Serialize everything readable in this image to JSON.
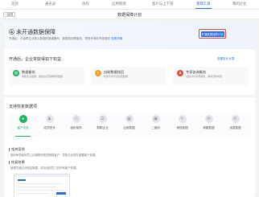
{
  "topnav": {
    "items": [
      "首页",
      "通讯录",
      "协作",
      "应用管理",
      "客户与上下游",
      "管理工具",
      "我的企业"
    ],
    "active_index": 5
  },
  "subbar": {
    "back_label": "返回",
    "title": "数据保障计划"
  },
  "hero": {
    "title": "未开通数据保障",
    "desc": "开通后，可保障企业核心数据的数据备份、数据找回等服务，享受专享的专家服务",
    "desc_link": "查看详情",
    "open_button": "开通数据保障计划"
  },
  "benefits": {
    "title": "开通后，企业将获得如下权益",
    "link": "查看定价计算",
    "items": [
      {
        "title": "数据备份",
        "desc": "保障企业数据，备份后可查看所有数据",
        "color": "#1fb35e",
        "icon": "archive-icon"
      },
      {
        "title": "自助数据找回",
        "desc": "支持不同方式找回数据",
        "color": "#f59a23",
        "icon": "refresh-icon"
      },
      {
        "title": "专家咨询服务",
        "desc": "包括1对1专家服务，需求及时响应",
        "color": "#e24a3b",
        "icon": "expert-icon"
      }
    ]
  },
  "types": {
    "title": "支持恢复数据项",
    "items": [
      {
        "label": "客户关系",
        "icon": "chat-icon",
        "glyph": "●"
      },
      {
        "label": "成员帐号",
        "icon": "user-icon",
        "glyph": "♟"
      },
      {
        "label": "组织架构",
        "icon": "org-icon",
        "glyph": "⚇"
      },
      {
        "label": "群聊企业",
        "icon": "group-icon",
        "glyph": "☰"
      },
      {
        "label": "应用数据",
        "icon": "app-icon",
        "glyph": "▦"
      },
      {
        "label": "二维码",
        "icon": "qrcode-icon",
        "glyph": "▣"
      },
      {
        "label": "审批数据",
        "icon": "approval-icon",
        "glyph": "✎"
      },
      {
        "label": "邮箱数据",
        "icon": "mail-icon",
        "glyph": "✉"
      },
      {
        "label": "消息数据",
        "icon": "message-icon",
        "glyph": "✆"
      }
    ],
    "active_index": 0
  },
  "info": {
    "scene_title": "相关案例",
    "scene_text": "因纷争导致的员工在离职前恶意删除客户，导致企业损失重要客户资源。",
    "result_title": "恢复效果",
    "result_text": "管理员通过此恢复数据，成功找回员工的所有客户资源。"
  }
}
